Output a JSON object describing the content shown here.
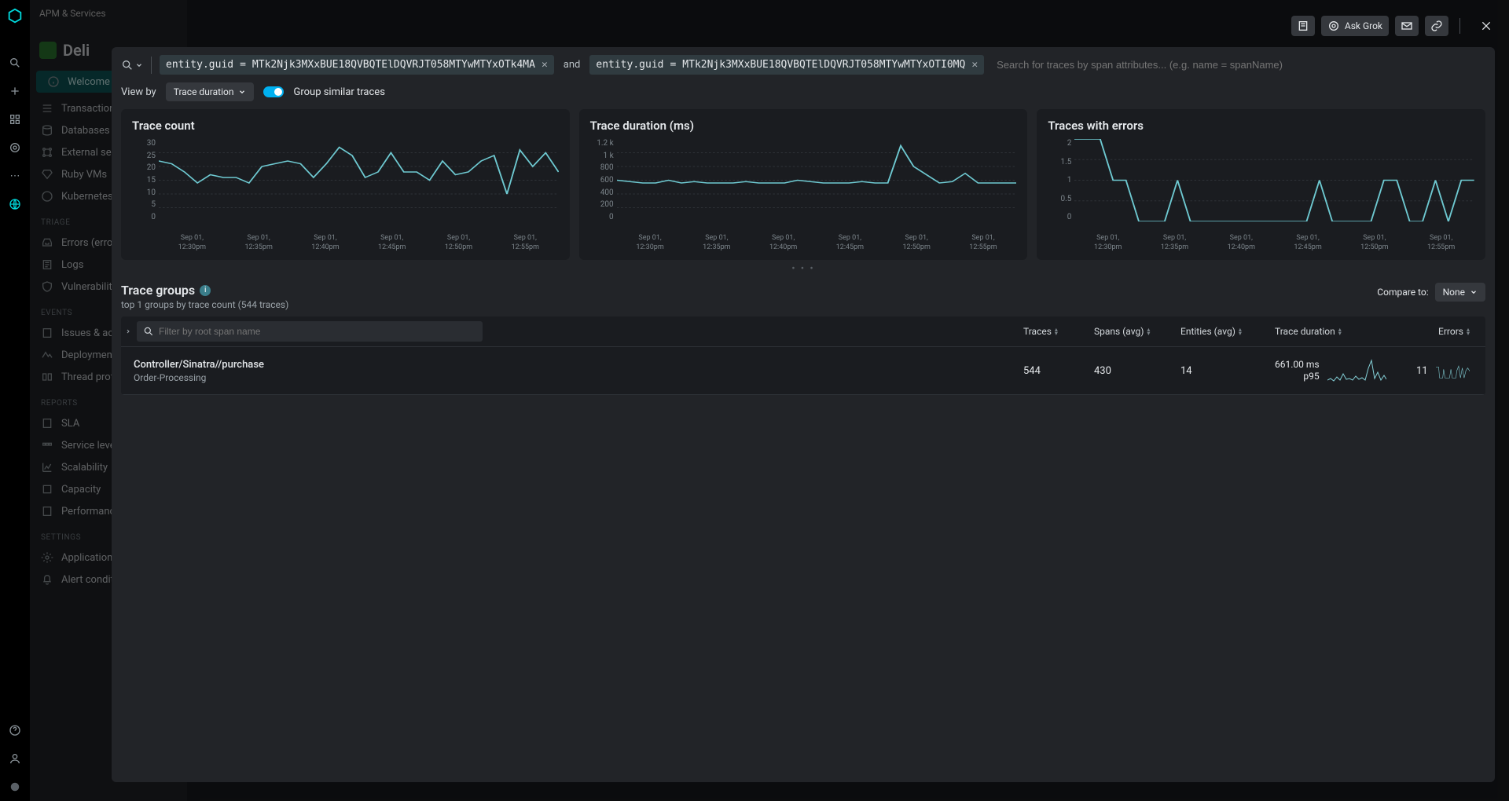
{
  "sidebar": {
    "breadcrumb": "APM & Services",
    "app_name": "Deli",
    "welcome": "Welcome",
    "items_monitor": [
      "Transactions",
      "Databases",
      "External services",
      "Ruby VMs",
      "Kubernetes"
    ],
    "cat_triage": "TRIAGE",
    "items_triage": [
      "Errors (errors inbox)",
      "Logs",
      "Vulnerabilities"
    ],
    "cat_events": "EVENTS",
    "items_events": [
      "Issues & activity",
      "Deployments",
      "Thread profiler"
    ],
    "cat_reports": "REPORTS",
    "items_reports": [
      "SLA",
      "Service levels",
      "Scalability",
      "Capacity",
      "Performance"
    ],
    "cat_settings": "SETTINGS",
    "items_settings": [
      "Application",
      "Alert conditions"
    ]
  },
  "topbar": {
    "ask_grok": "Ask Grok"
  },
  "search": {
    "filter1_attr": "entity.guid",
    "filter1_op": "=",
    "filter1_val": "MTk2Njk3MXxBUE18QVBQTElDQVRJT058MTYwMTYxOTk4MA",
    "and": "and",
    "filter2_attr": "entity.guid",
    "filter2_op": "=",
    "filter2_val": "MTk2Njk3MXxBUE18QVBQTElDQVRJT058MTYwMTYxOTI0MQ",
    "placeholder": "Search for traces by span attributes... (e.g. name = spanName)"
  },
  "viewby": {
    "label": "View by",
    "value": "Trace duration",
    "toggle_label": "Group similar traces"
  },
  "charts": {
    "c1_title": "Trace count",
    "c2_title": "Trace duration (ms)",
    "c3_title": "Traces with errors"
  },
  "chart_data": [
    {
      "type": "line",
      "title": "Trace count",
      "x_ticks": [
        "Sep 01, 12:30pm",
        "Sep 01, 12:35pm",
        "Sep 01, 12:40pm",
        "Sep 01, 12:45pm",
        "Sep 01, 12:50pm",
        "Sep 01, 12:55pm"
      ],
      "y_ticks": [
        0,
        5,
        10,
        15,
        20,
        25,
        30
      ],
      "ylim": [
        0,
        30
      ],
      "values": [
        22,
        21,
        18,
        14,
        17,
        16,
        16,
        14,
        20,
        21,
        22,
        21,
        16,
        21,
        27,
        24,
        16,
        18,
        25,
        18,
        18,
        15,
        22,
        17,
        18,
        22,
        24,
        10,
        26,
        20,
        25,
        18
      ]
    },
    {
      "type": "line",
      "title": "Trace duration (ms)",
      "x_ticks": [
        "Sep 01, 12:30pm",
        "Sep 01, 12:35pm",
        "Sep 01, 12:40pm",
        "Sep 01, 12:45pm",
        "Sep 01, 12:50pm",
        "Sep 01, 12:55pm"
      ],
      "y_ticks": [
        0,
        200,
        400,
        600,
        800,
        "1 k",
        "1.2 k"
      ],
      "ylim": [
        0,
        1200
      ],
      "values": [
        600,
        580,
        560,
        560,
        600,
        560,
        580,
        560,
        560,
        560,
        580,
        560,
        560,
        560,
        600,
        580,
        560,
        560,
        560,
        580,
        560,
        560,
        1103,
        800,
        680,
        560,
        580,
        700,
        560,
        560,
        560,
        560
      ]
    },
    {
      "type": "line",
      "title": "Traces with errors",
      "x_ticks": [
        "Sep 01, 12:30pm",
        "Sep 01, 12:35pm",
        "Sep 01, 12:40pm",
        "Sep 01, 12:45pm",
        "Sep 01, 12:50pm",
        "Sep 01, 12:55pm"
      ],
      "y_ticks": [
        0,
        0.5,
        1,
        1.5,
        2
      ],
      "ylim": [
        0,
        2
      ],
      "values": [
        2,
        2,
        2,
        1,
        1,
        0,
        0,
        0,
        1,
        0,
        0,
        0,
        0,
        0,
        0,
        0,
        0,
        0,
        0,
        1,
        0,
        0,
        0,
        0,
        1,
        1,
        0,
        0,
        1,
        0,
        1,
        1
      ]
    }
  ],
  "trace_groups": {
    "title": "Trace groups",
    "subtitle": "top 1 groups by trace count (544 traces)",
    "compare_label": "Compare to:",
    "compare_value": "None",
    "filter_placeholder": "Filter by root span name",
    "headers": {
      "traces": "Traces",
      "spans": "Spans (avg)",
      "entities": "Entities (avg)",
      "duration": "Trace duration",
      "errors": "Errors"
    },
    "rows": [
      {
        "name": "Controller/Sinatra//purchase",
        "service": "Order-Processing",
        "traces": "544",
        "spans": "430",
        "entities": "14",
        "duration_val": "661.00 ms",
        "duration_stat": "p95",
        "errors": "11"
      }
    ]
  }
}
